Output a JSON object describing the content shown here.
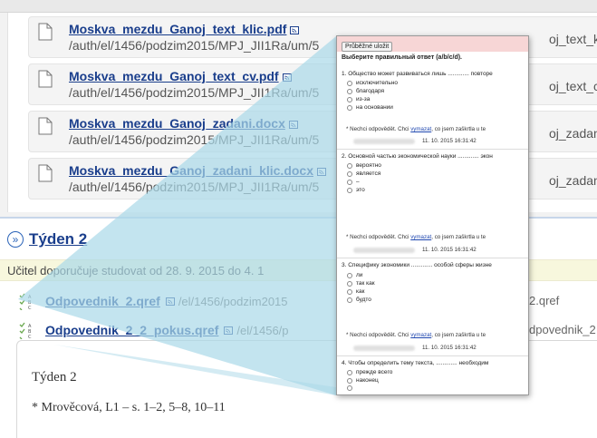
{
  "files": [
    {
      "name": "Moskva_mezdu_Ganoj_text_klic.pdf",
      "path": "/auth/el/1456/podzim2015/MPJ_JII1Ra/um/5",
      "right": "oj_text_klic."
    },
    {
      "name": "Moskva_mezdu_Ganoj_text_cv.pdf",
      "path": "/auth/el/1456/podzim2015/MPJ_JII1Ra/um/5",
      "right": "oj_text_cv.p"
    },
    {
      "name": "Moskva_mezdu_Ganoj_zadani.docx",
      "path": "/auth/el/1456/podzim2015/MPJ_JII1Ra/um/5",
      "right": "oj_zadani.d"
    },
    {
      "name": "Moskva_mezdu_Ganoj_zadani_klic.docx",
      "path": "/auth/el/1456/podzim2015/MPJ_JII1Ra/um/5",
      "right": "oj_zadani_k"
    }
  ],
  "week": {
    "title": "Týden 2",
    "notice": "Učitel doporučuje studovat od 28. 9. 2015 do 4. 1",
    "quizzes": [
      {
        "name": "Odpovednik_2.qref",
        "path": "/el/1456/podzim2015",
        "right": "2.qref"
      },
      {
        "name": "Odpovednik_2_2_pokus.qref",
        "path": "/el/1456/p",
        "right": "dpovednik_2"
      }
    ],
    "doc_title": "Týden 2",
    "doc_line": "* Mrověcová, L1 –  s. 1–2, 5–8, 10–11"
  },
  "popup": {
    "save_label": "Průběžné uložit",
    "heading": "Выберите правильный ответ (a/b/c/d).",
    "questions": [
      {
        "text": "1. Общество может развиваться лишь ............. повторе",
        "options": [
          "исключительно",
          "благодаря",
          "из-за",
          "на основании"
        ]
      },
      {
        "text": "2. Основной частью экономической науки ............. экон",
        "options": [
          "вероятно",
          "является",
          "–",
          "это"
        ]
      },
      {
        "text": "3. Специфику экономики ............. особой сферы жизне",
        "options": [
          "ли",
          "так как",
          "как",
          "будто"
        ]
      },
      {
        "text": "4. Чтобы определить тему текста, ............. необходим",
        "options": [
          "прежде всего",
          "наконец"
        ]
      }
    ],
    "answer_prefix": "* Nechci odpovědět. Chci ",
    "answer_link": "vymazat",
    "answer_suffix": ", co jsem zaškrtla u te",
    "stamp_date": "11. 10. 2015 16:31:42"
  },
  "colors": {
    "link": "#1a3e8c",
    "notice_bg": "#f7f7dd",
    "callout": "#a9d8e8",
    "popup_topbar": "#f7d6d6"
  },
  "icons": {
    "file": "document-icon",
    "feed": "rss-icon",
    "quiz": "quiz-abc-icon",
    "expand": "double-chevron-icon"
  }
}
